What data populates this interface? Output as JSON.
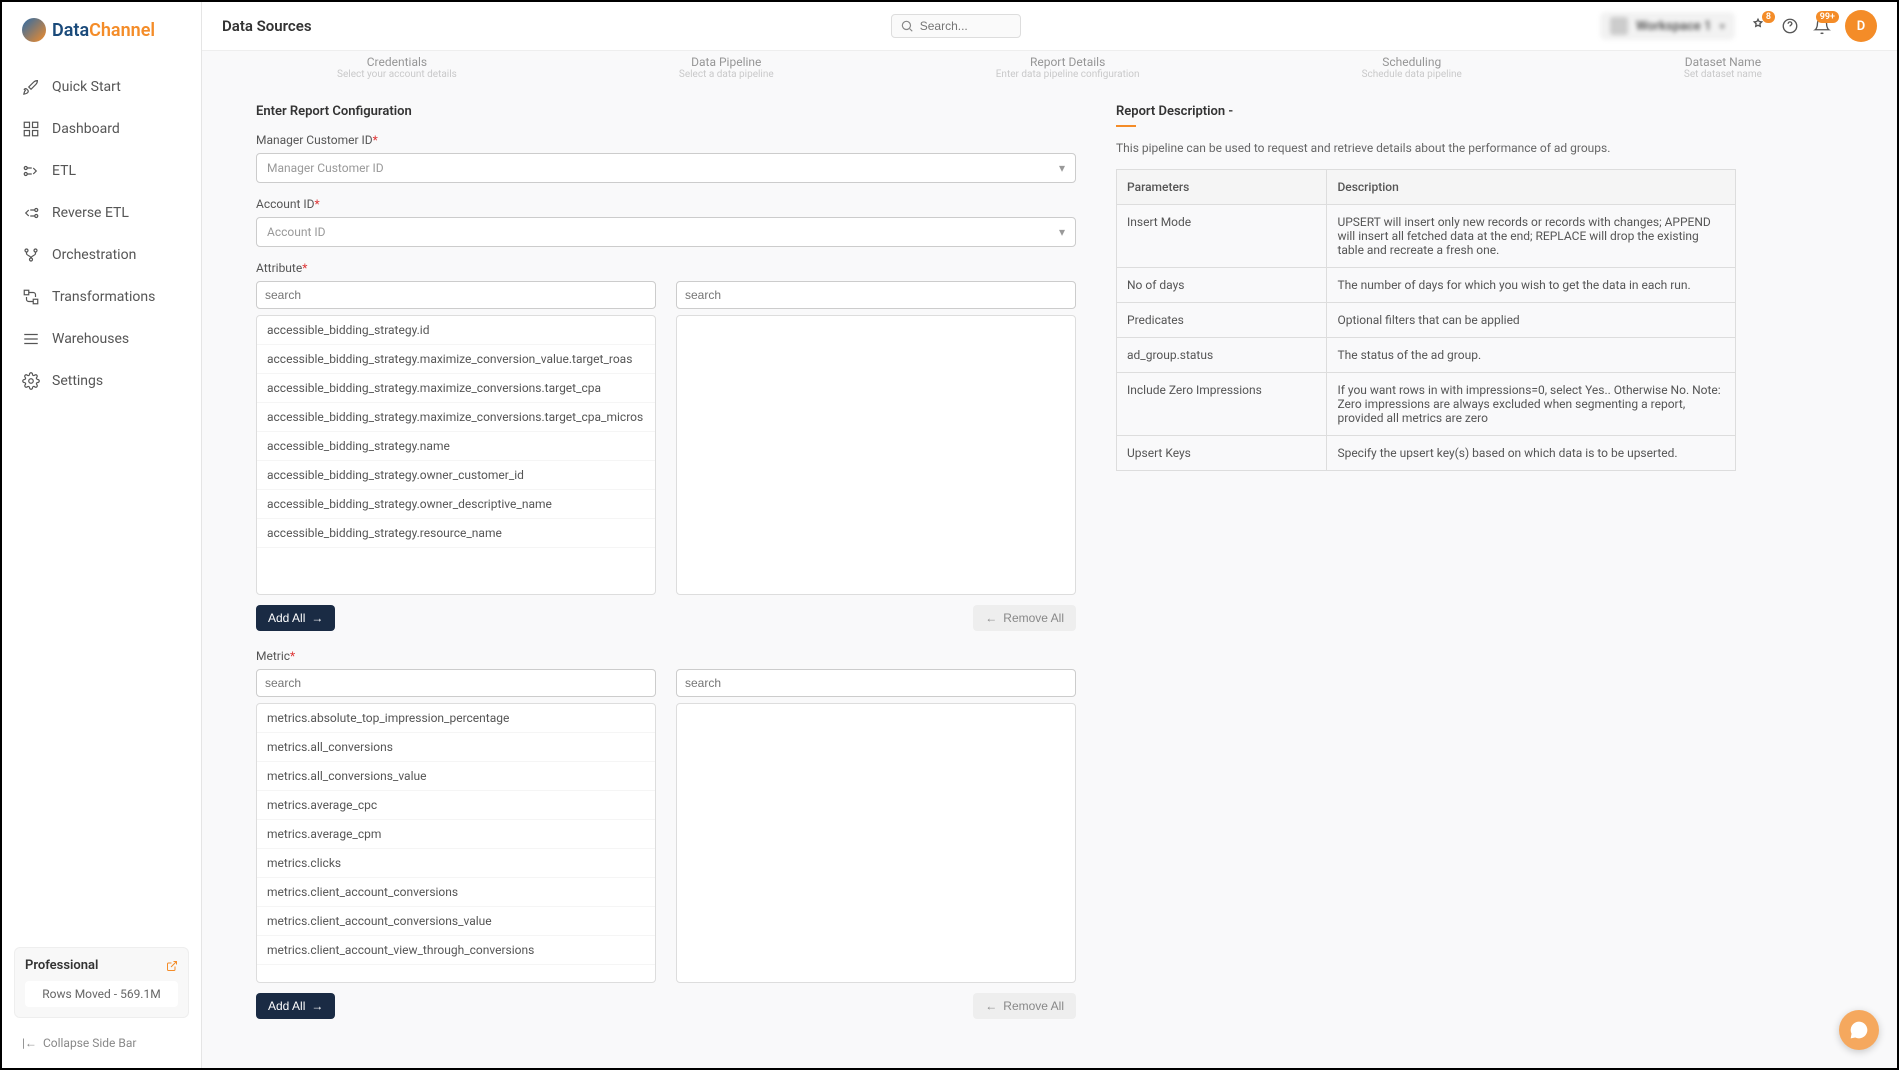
{
  "logo": {
    "brand_a": "Data",
    "brand_b": "Channel"
  },
  "nav": {
    "items": [
      {
        "label": "Quick Start"
      },
      {
        "label": "Dashboard"
      },
      {
        "label": "ETL"
      },
      {
        "label": "Reverse ETL"
      },
      {
        "label": "Orchestration"
      },
      {
        "label": "Transformations"
      },
      {
        "label": "Warehouses"
      },
      {
        "label": "Settings"
      }
    ]
  },
  "plan": {
    "name": "Professional",
    "rows": "Rows Moved - 569.1M"
  },
  "collapse_label": "Collapse Side Bar",
  "topbar": {
    "title": "Data Sources",
    "search_placeholder": "Search...",
    "workspace": "Workspace 1",
    "badge_notif": "8",
    "badge_bell": "99+",
    "avatar_initial": "D"
  },
  "steps": [
    {
      "title": "Credentials",
      "sub": "Select your account details"
    },
    {
      "title": "Data Pipeline",
      "sub": "Select a data pipeline"
    },
    {
      "title": "Report Details",
      "sub": "Enter data pipeline configuration"
    },
    {
      "title": "Scheduling",
      "sub": "Schedule data pipeline"
    },
    {
      "title": "Dataset Name",
      "sub": "Set dataset name"
    }
  ],
  "form": {
    "section_title": "Enter Report Configuration",
    "manager_label": "Manager Customer ID",
    "manager_placeholder": "Manager Customer ID",
    "account_label": "Account ID",
    "account_placeholder": "Account ID",
    "attribute_label": "Attribute",
    "metric_label": "Metric",
    "search_placeholder": "search",
    "add_all": "Add All",
    "remove_all": "Remove All",
    "attributes": [
      "accessible_bidding_strategy.id",
      "accessible_bidding_strategy.maximize_conversion_value.target_roas",
      "accessible_bidding_strategy.maximize_conversions.target_cpa",
      "accessible_bidding_strategy.maximize_conversions.target_cpa_micros",
      "accessible_bidding_strategy.name",
      "accessible_bidding_strategy.owner_customer_id",
      "accessible_bidding_strategy.owner_descriptive_name",
      "accessible_bidding_strategy.resource_name"
    ],
    "metrics": [
      "metrics.absolute_top_impression_percentage",
      "metrics.all_conversions",
      "metrics.all_conversions_value",
      "metrics.average_cpc",
      "metrics.average_cpm",
      "metrics.clicks",
      "metrics.client_account_conversions",
      "metrics.client_account_conversions_value",
      "metrics.client_account_view_through_conversions"
    ]
  },
  "description": {
    "title": "Report Description -",
    "text": "This pipeline can be used to request and retrieve details about the performance of ad groups.",
    "headers": {
      "param": "Parameters",
      "desc": "Description"
    },
    "rows": [
      {
        "param": "Insert Mode",
        "desc": "UPSERT will insert only new records or records with changes; APPEND will insert all fetched data at the end; REPLACE will drop the existing table and recreate a fresh one."
      },
      {
        "param": "No of days",
        "desc": "The number of days for which you wish to get the data in each run."
      },
      {
        "param": "Predicates",
        "desc": "Optional filters that can be applied"
      },
      {
        "param": "ad_group.status",
        "desc": "The status of the ad group."
      },
      {
        "param": "Include Zero Impressions",
        "desc": "If you want rows in with impressions=0, select Yes.. Otherwise No. Note: Zero impressions are always excluded when segmenting a report, provided all metrics are zero"
      },
      {
        "param": "Upsert Keys",
        "desc": "Specify the upsert key(s) based on which data is to be upserted."
      }
    ]
  }
}
